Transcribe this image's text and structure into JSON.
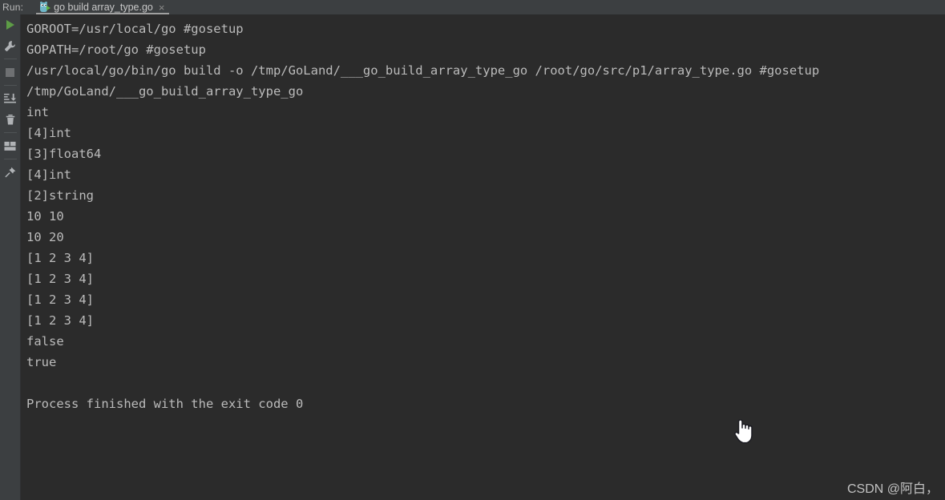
{
  "header": {
    "run_label": "Run:",
    "tab": {
      "title": "go build array_type.go",
      "icon": "go-gopher-run-icon",
      "close_label": "×"
    }
  },
  "side_toolbar": {
    "items": [
      {
        "name": "rerun-button",
        "icon": "play-icon",
        "label": "Rerun"
      },
      {
        "name": "settings-button",
        "icon": "wrench-icon",
        "label": "Settings"
      },
      {
        "name": "stop-button",
        "icon": "stop-icon",
        "label": "Stop"
      },
      {
        "name": "scroll-to-end-button",
        "icon": "scroll-to-end-icon",
        "label": "Scroll to end"
      },
      {
        "name": "clear-all-button",
        "icon": "trash-icon",
        "label": "Clear All"
      },
      {
        "name": "layout-button",
        "icon": "layout-icon",
        "label": "Layout"
      },
      {
        "name": "pin-tab-button",
        "icon": "pin-icon",
        "label": "Pin Tab"
      }
    ]
  },
  "console": {
    "lines": [
      "GOROOT=/usr/local/go #gosetup",
      "GOPATH=/root/go #gosetup",
      "/usr/local/go/bin/go build -o /tmp/GoLand/___go_build_array_type_go /root/go/src/p1/array_type.go #gosetup",
      "/tmp/GoLand/___go_build_array_type_go",
      "int",
      "[4]int",
      "[3]float64",
      "[4]int",
      "[2]string",
      "10 10",
      "10 20",
      "[1 2 3 4]",
      "[1 2 3 4]",
      "[1 2 3 4]",
      "[1 2 3 4]",
      "false",
      "true",
      "",
      "Process finished with the exit code 0"
    ]
  },
  "watermark": {
    "text": "CSDN @阿白，"
  },
  "colors": {
    "console_bg": "#2b2b2b",
    "chrome_bg": "#3c3f41",
    "console_text": "#bbbbbb",
    "run_green": "#5d9c46",
    "gopher_blue": "#6fb7c9"
  }
}
